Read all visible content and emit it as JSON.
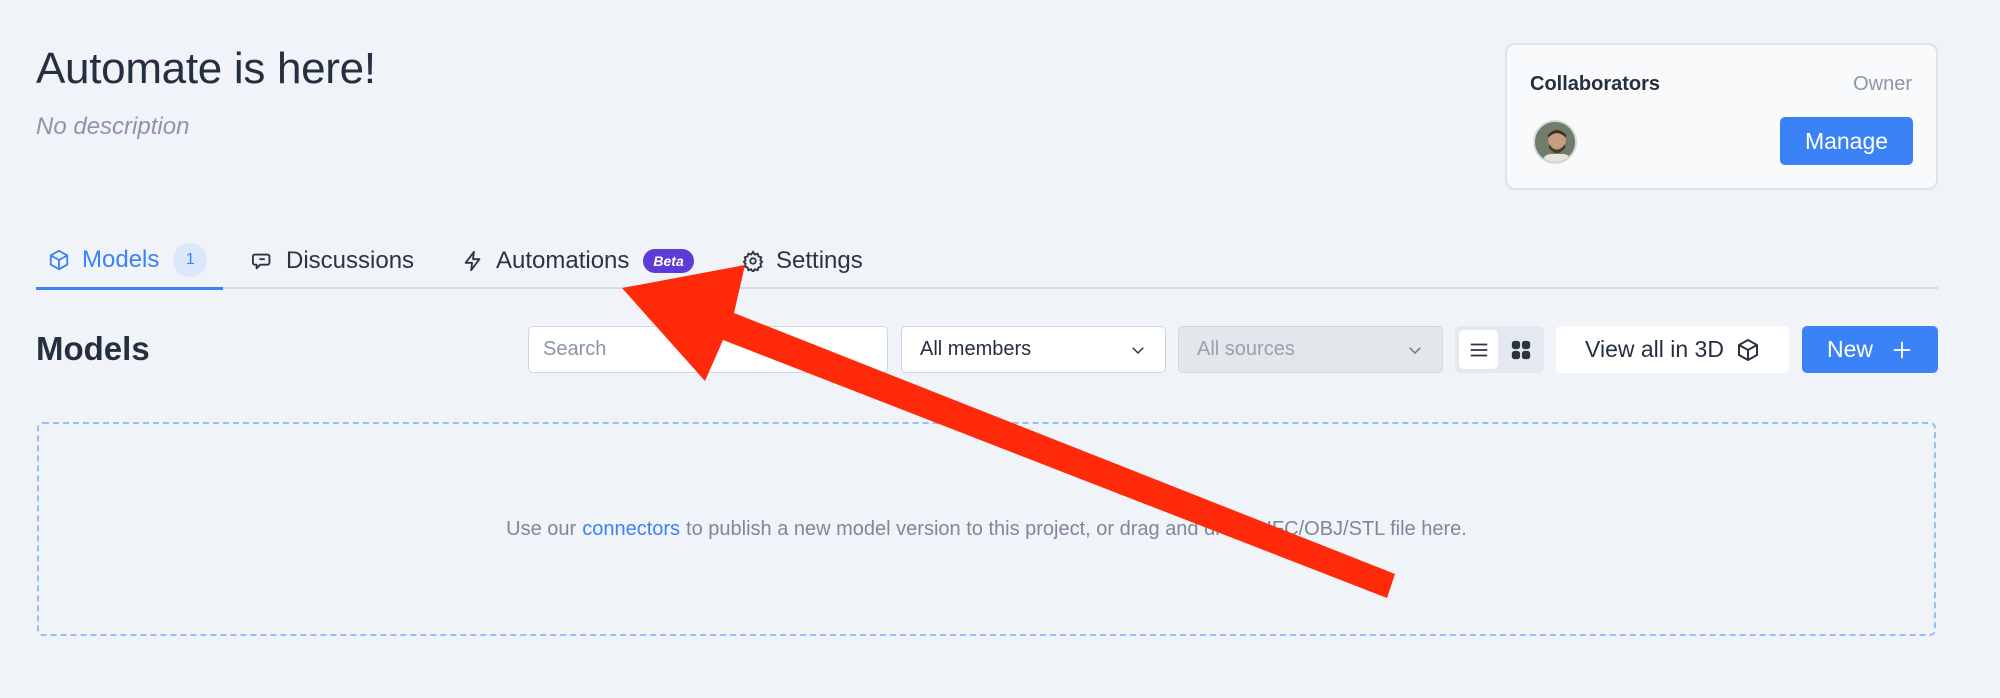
{
  "project": {
    "title": "Automate is here!",
    "description": "No description"
  },
  "collaborators": {
    "title": "Collaborators",
    "role": "Owner",
    "manage_label": "Manage"
  },
  "tabs": [
    {
      "label": "Models",
      "count": "1",
      "icon": "cube-icon",
      "active": true
    },
    {
      "label": "Discussions",
      "icon": "chat-icon"
    },
    {
      "label": "Automations",
      "badge": "Beta",
      "icon": "bolt-icon"
    },
    {
      "label": "Settings",
      "icon": "gear-icon"
    }
  ],
  "models": {
    "title": "Models",
    "search_placeholder": "Search",
    "members_filter": "All members",
    "sources_filter": "All sources",
    "view_all_label": "View all in 3D",
    "new_label": "New"
  },
  "dropzone": {
    "text_before": "Use our",
    "link": "connectors",
    "text_after": "to publish a new model version to this project, or drag and drop a IFC/OBJ/STL file here."
  },
  "colors": {
    "accent": "#3b82f6",
    "beta_badge": "#5b3cd6",
    "annotation_arrow": "#ff2a0a"
  }
}
